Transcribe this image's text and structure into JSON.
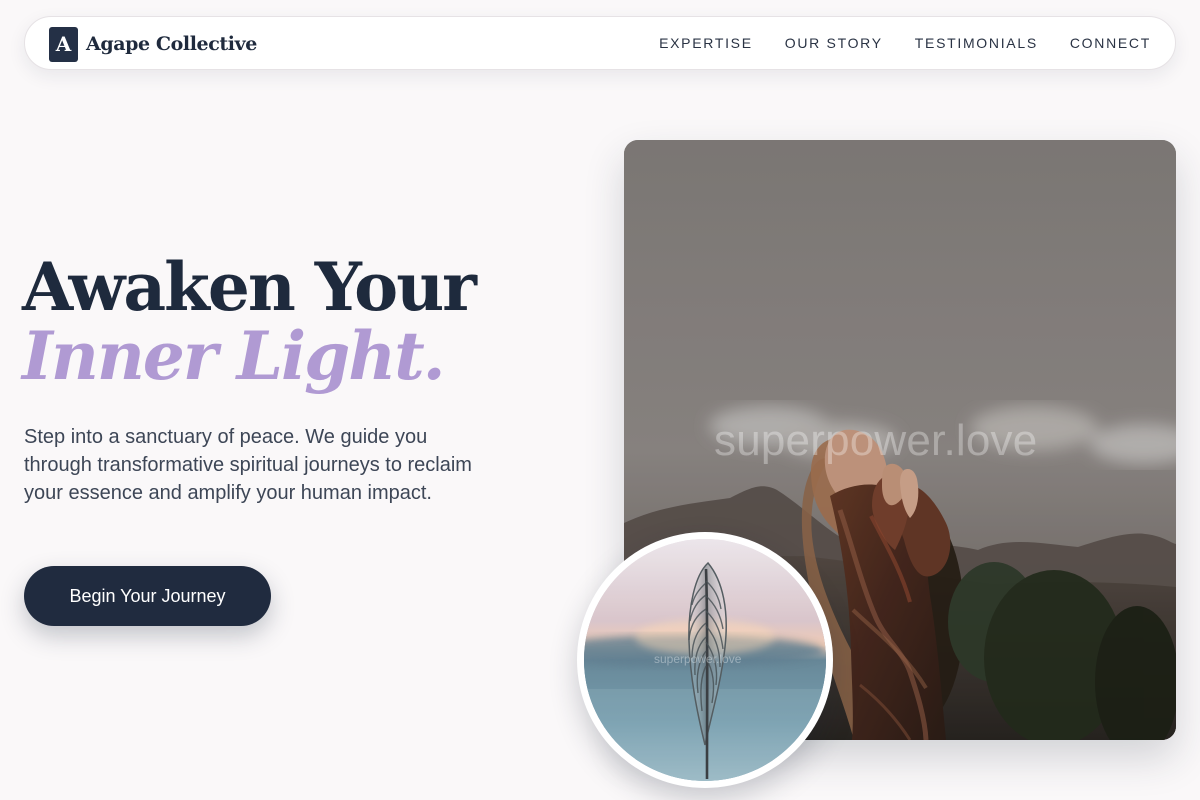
{
  "brand": {
    "mark": "A",
    "name": "Agape Collective"
  },
  "navigation": {
    "items": [
      {
        "label": "EXPERTISE"
      },
      {
        "label": "OUR STORY"
      },
      {
        "label": "TESTIMONIALS"
      },
      {
        "label": "CONNECT"
      }
    ]
  },
  "hero": {
    "title_line_1": "Awaken Your",
    "title_line_2": "Inner Light.",
    "description": "Step into a sanctuary of peace. We guide you through transformative spiritual journeys to reclaim your essence and amplify your human impact.",
    "cta_label": "Begin Your Journey",
    "main_image": {
      "watermark": "superpower.love"
    },
    "circle_image": {
      "watermark": "superpower.love"
    }
  },
  "colors": {
    "page_background": "#faf8f9",
    "navy": "#1f2a3d",
    "lavender": "#b09ad3",
    "body_text": "#3d4656",
    "white": "#ffffff"
  },
  "icons": {
    "brand_mark": "letter-a-logo"
  }
}
